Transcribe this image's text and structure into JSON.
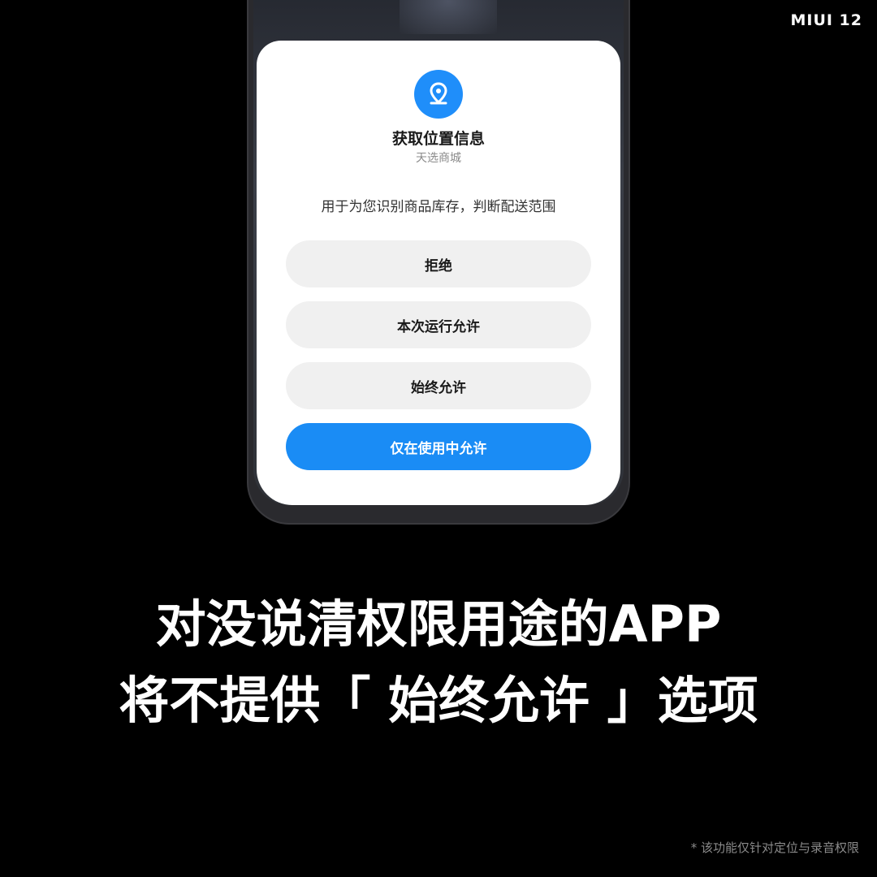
{
  "brand": {
    "logo_text": "MIUI 12"
  },
  "dialog": {
    "icon": "location-pin-icon",
    "title": "获取位置信息",
    "app_name": "天选商城",
    "description": "用于为您识别商品库存，判断配送范围",
    "buttons": [
      {
        "label": "拒绝",
        "style": "secondary"
      },
      {
        "label": "本次运行允许",
        "style": "secondary"
      },
      {
        "label": "始终允许",
        "style": "secondary"
      },
      {
        "label": "仅在使用中允许",
        "style": "primary"
      }
    ]
  },
  "headline": {
    "line1": "对没说清权限用途的APP",
    "line2": "将不提供「 始终允许 」选项"
  },
  "footnote": "* 该功能仅针对定位与录音权限",
  "colors": {
    "background": "#000000",
    "accent_blue": "#1a8cf5",
    "button_gray": "#f0f0f0",
    "dialog_bg": "#ffffff"
  }
}
